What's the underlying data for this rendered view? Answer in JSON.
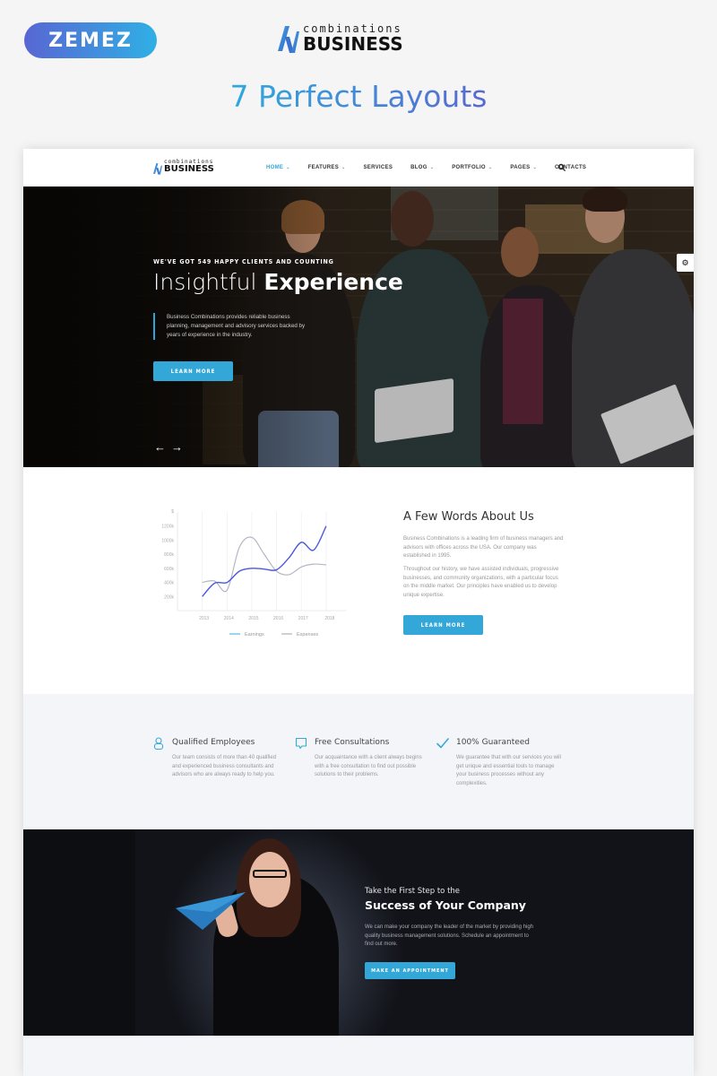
{
  "promo": {
    "badge": "ZEMEZ",
    "logo_small": "combinations",
    "logo_big": "BUSINESS",
    "title": "7 Perfect Layouts"
  },
  "colors": {
    "accent": "#33a8d8",
    "earnings_line": "#4b57e0",
    "expenses_line": "#b4b6c4",
    "legend_earnings": "#5ec3e6"
  },
  "nav": {
    "logo_small": "combinations",
    "logo_big": "BUSINESS",
    "items": [
      {
        "label": "Home",
        "dropdown": true,
        "active": true
      },
      {
        "label": "Features",
        "dropdown": true,
        "active": false
      },
      {
        "label": "Services",
        "dropdown": false,
        "active": false
      },
      {
        "label": "Blog",
        "dropdown": true,
        "active": false
      },
      {
        "label": "Portfolio",
        "dropdown": true,
        "active": false
      },
      {
        "label": "Pages",
        "dropdown": true,
        "active": false
      },
      {
        "label": "Contacts",
        "dropdown": false,
        "active": false
      }
    ],
    "chevron": "⌄",
    "search_icon": "search-icon"
  },
  "hero": {
    "kicker": "We've got 549 happy clients and counting",
    "title_light": "Insightful",
    "title_bold": "Experience",
    "description": "Business Combinations provides reliable business planning, management and advisory services backed by years of experience in the industry.",
    "button": "Learn more",
    "prev": "←",
    "next": "→",
    "settings_icon": "⚙"
  },
  "about": {
    "title": "A Few Words About Us",
    "p1": "Business Combinations is a leading firm of business managers and advisors with offices across the USA. Our company was established in 1995.",
    "p2": "Throughout our history, we have assisted individuals, progressive businesses, and community organizations, with a particular focus on the middle market. Our principles have enabled us to develop unique expertise.",
    "button": "Learn more"
  },
  "chart_data": {
    "type": "line",
    "title": "",
    "xlabel": "",
    "ylabel": "$",
    "x": [
      2013,
      2013.5,
      2014,
      2014.5,
      2015,
      2015.5,
      2016,
      2016.5,
      2017,
      2017.5,
      2018
    ],
    "x_tick_labels": [
      "2013",
      "2014",
      "2015",
      "2016",
      "2017",
      "2018"
    ],
    "y_tick_labels": [
      "$",
      "1200k",
      "1000k",
      "800k",
      "600k",
      "400k",
      "200k"
    ],
    "ylim": [
      0,
      1400
    ],
    "grid": true,
    "legend": "bottom",
    "series": [
      {
        "name": "Earnings",
        "values": [
          200,
          390,
          400,
          560,
          600,
          590,
          580,
          750,
          970,
          860,
          1200
        ]
      },
      {
        "name": "Expenses",
        "values": [
          400,
          420,
          290,
          900,
          1040,
          800,
          560,
          510,
          620,
          660,
          650
        ]
      }
    ]
  },
  "features": [
    {
      "icon": "user-icon",
      "title": "Qualified Employees",
      "text": "Our team consists of more than 40 qualified and experienced business consultants and advisors who are always ready to help you."
    },
    {
      "icon": "chat-bubble-icon",
      "title": "Free Consultations",
      "text": "Our acquaintance with a client always begins with a free consultation to find out possible solutions to their problems."
    },
    {
      "icon": "checkmark-icon",
      "title": "100% Guaranteed",
      "text": "We guarantee that with our services you will get unique and essential tools to manage your business processes without any complexities."
    }
  ],
  "cta": {
    "kicker": "Take the First Step to the",
    "title": "Success of Your Company",
    "text": "We can make your company the leader of the market by providing high quality business management solutions. Schedule an appointment to find out more.",
    "button": "Make an appointment"
  }
}
